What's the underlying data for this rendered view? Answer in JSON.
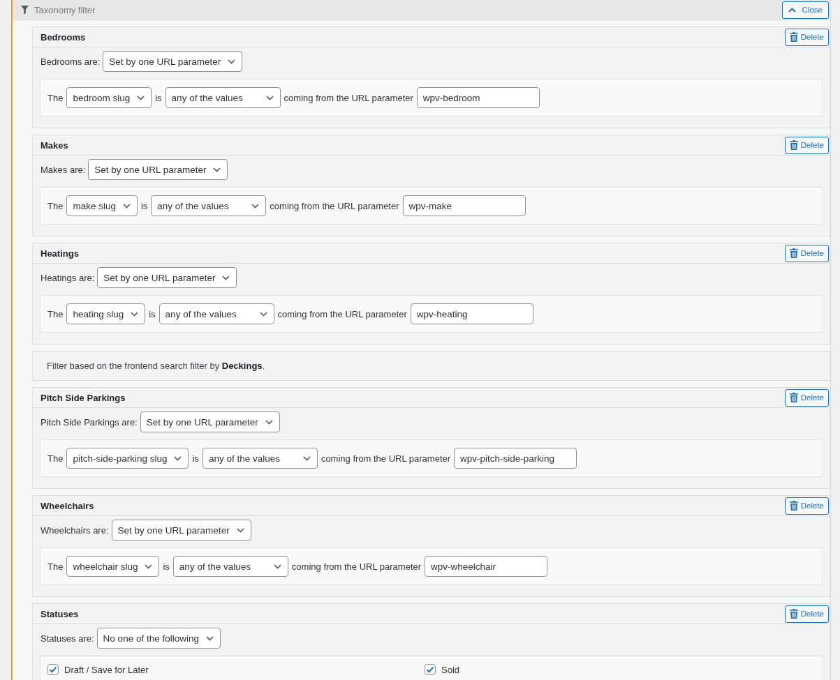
{
  "header": {
    "title": "Taxonomy filter",
    "close_button": "Close"
  },
  "filters": [
    {
      "kind": "url",
      "title": "Bedrooms",
      "delete_button": "Delete",
      "mode_label": "Bedrooms are:",
      "mode": "Set by one URL parameter",
      "condition": {
        "prefix": "The",
        "field": "bedroom slug",
        "connector": "is",
        "operator": "any of the values",
        "suffix": "coming from the URL parameter",
        "parameter": "wpv-bedroom"
      }
    },
    {
      "kind": "url",
      "title": "Makes",
      "delete_button": "Delete",
      "mode_label": "Makes are:",
      "mode": "Set by one URL parameter",
      "condition": {
        "prefix": "The",
        "field": "make slug",
        "connector": "is",
        "operator": "any of the values",
        "suffix": "coming from the URL parameter",
        "parameter": "wpv-make"
      }
    },
    {
      "kind": "url",
      "title": "Heatings",
      "delete_button": "Delete",
      "mode_label": "Heatings are:",
      "mode": "Set by one URL parameter",
      "condition": {
        "prefix": "The",
        "field": "heating slug",
        "connector": "is",
        "operator": "any of the values",
        "suffix": "coming from the URL parameter",
        "parameter": "wpv-heating"
      }
    },
    {
      "kind": "note",
      "text": "Filter based on the frontend search filter by **Deckings**."
    },
    {
      "kind": "url",
      "title": "Pitch Side Parkings",
      "delete_button": "Delete",
      "mode_label": "Pitch Side Parkings are:",
      "mode": "Set by one URL parameter",
      "condition": {
        "prefix": "The",
        "field": "pitch-side-parking slug",
        "connector": "is",
        "operator": "any of the values",
        "suffix": "coming from the URL parameter",
        "parameter": "wpv-pitch-side-parking"
      }
    },
    {
      "kind": "url",
      "title": "Wheelchairs",
      "delete_button": "Delete",
      "mode_label": "Wheelchairs are:",
      "mode": "Set by one URL parameter",
      "condition": {
        "prefix": "The",
        "field": "wheelchair slug",
        "connector": "is",
        "operator": "any of the values",
        "suffix": "coming from the URL parameter",
        "parameter": "wpv-wheelchair"
      }
    },
    {
      "kind": "checklist",
      "title": "Statuses",
      "delete_button": "Delete",
      "mode_label": "Statuses are:",
      "mode": "No one of the following",
      "options": [
        {
          "label": "Draft / Save for Later",
          "checked": true
        },
        {
          "label": "Sold",
          "checked": true
        }
      ]
    }
  ]
}
